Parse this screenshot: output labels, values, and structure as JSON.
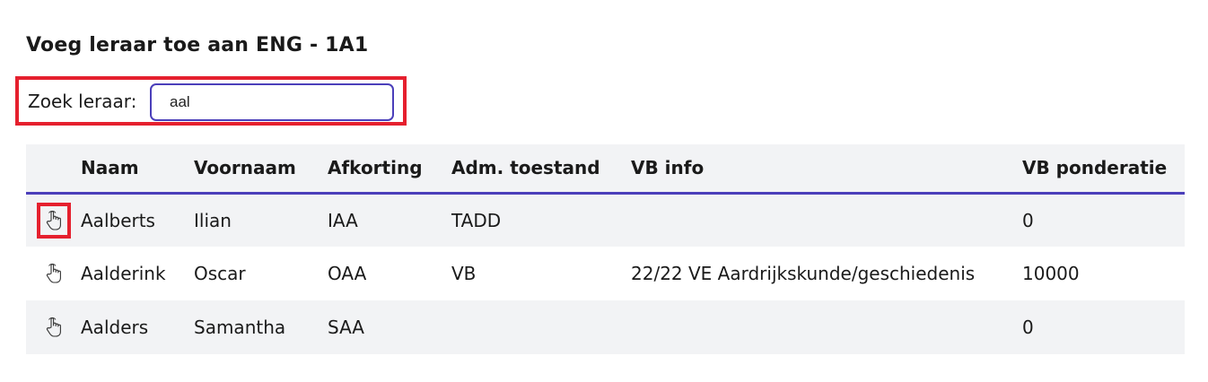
{
  "dialog": {
    "title": "Voeg leraar toe aan ENG - 1A1"
  },
  "search": {
    "label": "Zoek leraar:",
    "value": "aal"
  },
  "table": {
    "headers": {
      "naam": "Naam",
      "voornaam": "Voornaam",
      "afkorting": "Afkorting",
      "adm_toestand": "Adm. toestand",
      "vb_info": "VB info",
      "vb_ponderatie": "VB ponderatie"
    },
    "rows": [
      {
        "icon": "hand-pointer-icon",
        "naam": "Aalberts",
        "voornaam": "Ilian",
        "afkorting": "IAA",
        "adm_toestand": "TADD",
        "vb_info": "",
        "vb_ponderatie": "0"
      },
      {
        "icon": "hand-pointer-icon",
        "naam": "Aalderink",
        "voornaam": "Oscar",
        "afkorting": "OAA",
        "adm_toestand": "VB",
        "vb_info": "22/22 VE Aardrijkskunde/geschiedenis",
        "vb_ponderatie": "10000"
      },
      {
        "icon": "hand-pointer-icon",
        "naam": "Aalders",
        "voornaam": "Samantha",
        "afkorting": "SAA",
        "adm_toestand": "",
        "vb_info": "",
        "vb_ponderatie": "0"
      }
    ]
  },
  "colors": {
    "highlight": "#e5202e",
    "accent": "#4b3fba",
    "row_alt": "#f2f3f5"
  }
}
